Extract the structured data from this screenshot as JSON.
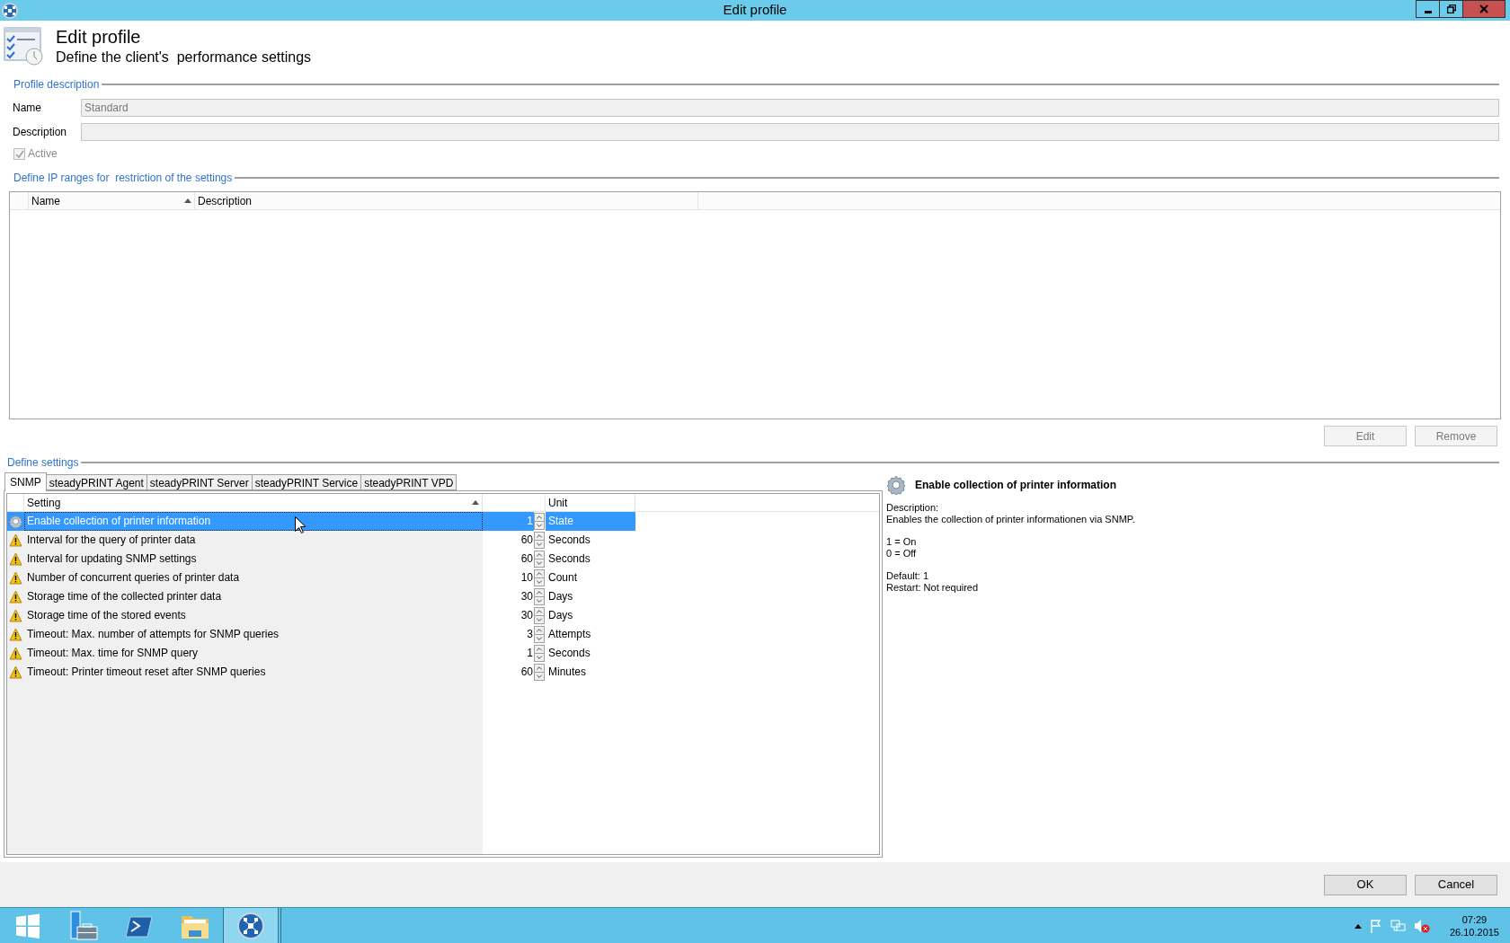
{
  "window": {
    "title": "Edit profile"
  },
  "header": {
    "title": "Edit profile",
    "subtitle": "Define the client's  performance settings"
  },
  "profile_description": {
    "legend": "Profile description",
    "fields": [
      {
        "label": "Name",
        "value": "Standard",
        "disabled": true
      },
      {
        "label": "Description",
        "disabled": true
      }
    ],
    "active": {
      "label": "Active",
      "checked": true,
      "disabled": true
    }
  },
  "ip_ranges": {
    "legend": "Define IP ranges for  restriction of the settings",
    "columns": [
      {
        "label": "Name",
        "sorted": true
      },
      {
        "label": "Description",
        "sorted": false
      }
    ],
    "buttons": [
      {
        "label": "Edit",
        "disabled": true
      },
      {
        "label": "Remove",
        "disabled": true
      }
    ]
  },
  "settings": {
    "legend": "Define settings",
    "tabs": [
      {
        "label": "SNMP",
        "selected": true
      },
      {
        "label": "steadyPRINT Agent",
        "selected": false
      },
      {
        "label": "steadyPRINT Server",
        "selected": false
      },
      {
        "label": "steadyPRINT Service",
        "selected": false
      },
      {
        "label": "steadyPRINT VPD",
        "selected": false
      }
    ],
    "columns": [
      {
        "label": "Setting",
        "sorted": true
      },
      {
        "label": "Unit",
        "sorted": false
      }
    ],
    "rows": [
      {
        "kind": "info",
        "setting": "Enable collection of printer information",
        "value": "1",
        "unit": "State",
        "selected": true
      },
      {
        "kind": "warning",
        "setting": "Interval for the query of printer data",
        "value": "60",
        "unit": "Seconds",
        "selected": false
      },
      {
        "kind": "warning",
        "setting": "Interval for updating SNMP settings",
        "value": "60",
        "unit": "Seconds",
        "selected": false
      },
      {
        "kind": "warning",
        "setting": "Number of concurrent queries of printer data",
        "value": "10",
        "unit": "Count",
        "selected": false
      },
      {
        "kind": "warning",
        "setting": "Storage time of the collected printer data",
        "value": "30",
        "unit": "Days",
        "selected": false
      },
      {
        "kind": "warning",
        "setting": "Storage time of the stored events",
        "value": "30",
        "unit": "Days",
        "selected": false
      },
      {
        "kind": "warning",
        "setting": "Timeout: Max. number of attempts for SNMP queries",
        "value": "3",
        "unit": "Attempts",
        "selected": false
      },
      {
        "kind": "warning",
        "setting": "Timeout: Max. time for SNMP query",
        "value": "1",
        "unit": "Seconds",
        "selected": false
      },
      {
        "kind": "warning",
        "setting": "Timeout: Printer timeout reset after SNMP queries",
        "value": "60",
        "unit": "Minutes",
        "selected": false
      }
    ]
  },
  "detail": {
    "title": "Enable collection of printer information",
    "paragraphs": [
      [
        "Description:",
        "Enables the collection of printer informationen via SNMP."
      ],
      [
        "1 = On",
        "0 = Off"
      ],
      [
        "Default: 1",
        "Restart: Not required"
      ]
    ]
  },
  "buttons": [
    {
      "label": "OK"
    },
    {
      "label": "Cancel"
    }
  ],
  "taskbar": {
    "apps": [
      {
        "kind": "start",
        "active": false
      },
      {
        "kind": "server",
        "active": false
      },
      {
        "kind": "shell",
        "active": false
      },
      {
        "kind": "folder",
        "active": false
      },
      {
        "kind": "network",
        "active": true
      }
    ],
    "clock": {
      "time": "07:29",
      "date": "26.10.2015"
    }
  }
}
